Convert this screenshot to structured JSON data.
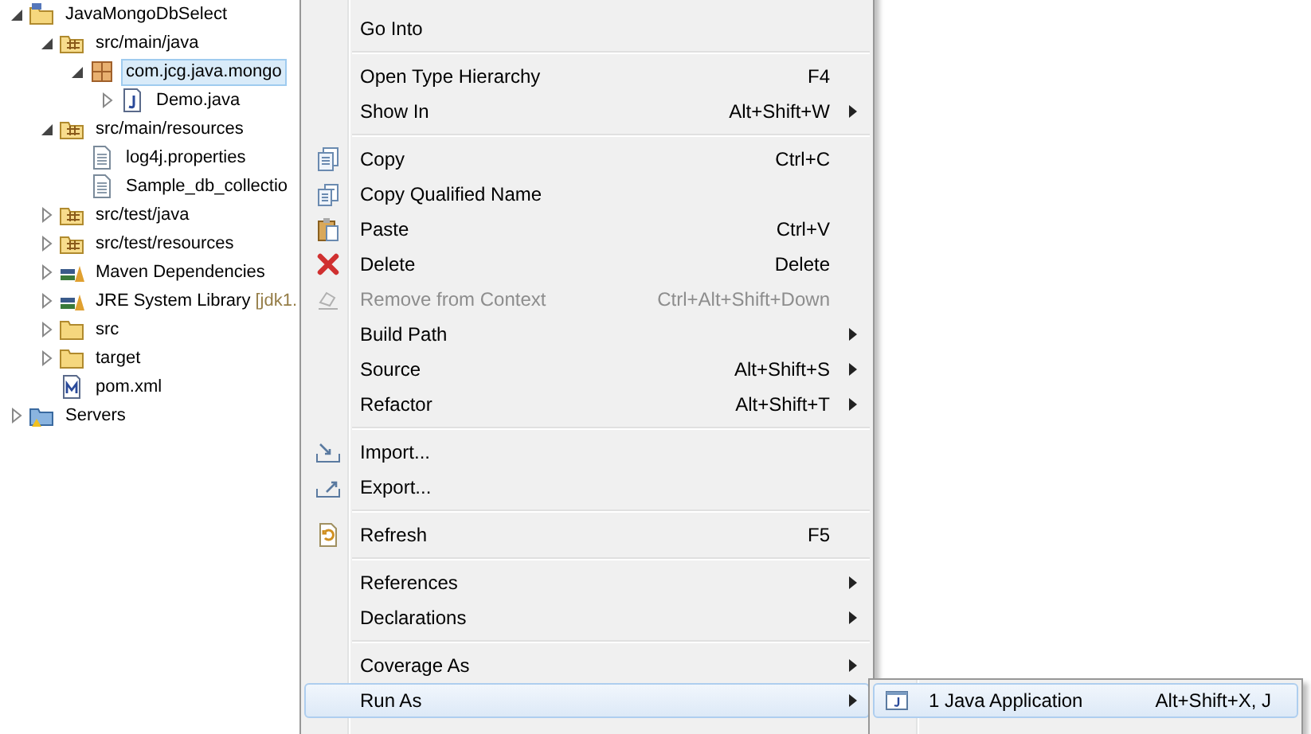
{
  "project_explorer": {
    "tree": [
      {
        "label": "JavaMongoDbSelect",
        "kind": "project",
        "expanded": true,
        "selected": false,
        "children": [
          {
            "label": "src/main/java",
            "kind": "source-folder",
            "expanded": true,
            "selected": false,
            "children": [
              {
                "label": "com.jcg.java.mongo",
                "kind": "package",
                "expanded": true,
                "selected": true,
                "children": [
                  {
                    "label": "Demo.java",
                    "kind": "java-file",
                    "expanded": false,
                    "selected": false
                  }
                ]
              }
            ]
          },
          {
            "label": "src/main/resources",
            "kind": "source-folder",
            "expanded": true,
            "selected": false,
            "children": [
              {
                "label": "log4j.properties",
                "kind": "file",
                "selected": false
              },
              {
                "label": "Sample_db_collectio",
                "kind": "file",
                "selected": false
              }
            ]
          },
          {
            "label": "src/test/java",
            "kind": "source-folder",
            "expanded": false,
            "selected": false
          },
          {
            "label": "src/test/resources",
            "kind": "source-folder",
            "expanded": false,
            "selected": false
          },
          {
            "label": "Maven Dependencies",
            "kind": "library",
            "expanded": false,
            "selected": false
          },
          {
            "label": "JRE System Library",
            "decoration": "[jdk1.",
            "kind": "library",
            "expanded": false,
            "selected": false
          },
          {
            "label": "src",
            "kind": "folder",
            "expanded": false,
            "selected": false
          },
          {
            "label": "target",
            "kind": "folder",
            "expanded": false,
            "selected": false
          },
          {
            "label": "pom.xml",
            "kind": "pom",
            "selected": false
          }
        ]
      },
      {
        "label": "Servers",
        "kind": "servers",
        "expanded": false,
        "selected": false
      }
    ]
  },
  "context_menu": {
    "groups": [
      [
        {
          "label": "Go Into",
          "submenu": false,
          "selected": false,
          "disabled": false
        }
      ],
      [
        {
          "label": "Open Type Hierarchy",
          "shortcut": "F4",
          "submenu": false,
          "selected": false,
          "disabled": false
        },
        {
          "label": "Show In",
          "shortcut": "Alt+Shift+W",
          "submenu": true,
          "selected": false,
          "disabled": false
        }
      ],
      [
        {
          "label": "Copy",
          "shortcut": "Ctrl+C",
          "submenu": false,
          "selected": false,
          "disabled": false
        },
        {
          "label": "Copy Qualified Name",
          "submenu": false,
          "selected": false,
          "disabled": false
        },
        {
          "label": "Paste",
          "shortcut": "Ctrl+V",
          "submenu": false,
          "selected": false,
          "disabled": false
        },
        {
          "label": "Delete",
          "shortcut": "Delete",
          "submenu": false,
          "selected": false,
          "disabled": false
        },
        {
          "label": "Remove from Context",
          "shortcut": "Ctrl+Alt+Shift+Down",
          "submenu": false,
          "selected": false,
          "disabled": true
        },
        {
          "label": "Build Path",
          "submenu": true,
          "selected": false,
          "disabled": false
        },
        {
          "label": "Source",
          "shortcut": "Alt+Shift+S",
          "submenu": true,
          "selected": false,
          "disabled": false
        },
        {
          "label": "Refactor",
          "shortcut": "Alt+Shift+T",
          "submenu": true,
          "selected": false,
          "disabled": false
        }
      ],
      [
        {
          "label": "Import...",
          "submenu": false,
          "selected": false,
          "disabled": false
        },
        {
          "label": "Export...",
          "submenu": false,
          "selected": false,
          "disabled": false
        }
      ],
      [
        {
          "label": "Refresh",
          "shortcut": "F5",
          "submenu": false,
          "selected": false,
          "disabled": false
        }
      ],
      [
        {
          "label": "References",
          "submenu": true,
          "selected": false,
          "disabled": false
        },
        {
          "label": "Declarations",
          "submenu": true,
          "selected": false,
          "disabled": false
        }
      ],
      [
        {
          "label": "Coverage As",
          "submenu": true,
          "selected": false,
          "disabled": false
        },
        {
          "label": "Run As",
          "submenu": true,
          "selected": true,
          "disabled": false
        }
      ]
    ]
  },
  "run_as_submenu": {
    "items": [
      {
        "label": "1 Java Application",
        "shortcut": "Alt+Shift+X, J",
        "selected": true
      }
    ]
  }
}
